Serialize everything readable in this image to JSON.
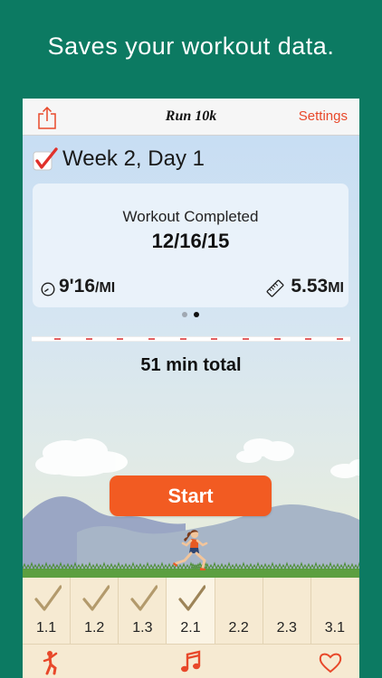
{
  "promo": {
    "headline": "Saves your workout data."
  },
  "navbar": {
    "title": "Run 10k",
    "settings_label": "Settings",
    "share_icon": "share-icon"
  },
  "workout": {
    "week_day": "Week 2, Day 1",
    "checked": true,
    "status": "Workout Completed",
    "date": "12/16/15",
    "pace_value": "9'16",
    "pace_unit": "/MI",
    "distance_value": "5.53",
    "distance_unit": "MI",
    "total": "51 min total"
  },
  "pager": {
    "pages": 2,
    "current_page": 2
  },
  "progress": {
    "segments": 10
  },
  "start_label": "Start",
  "days": [
    {
      "label": "1.1",
      "done": true
    },
    {
      "label": "1.2",
      "done": true
    },
    {
      "label": "1.3",
      "done": true
    },
    {
      "label": "2.1",
      "done": true,
      "current": true
    },
    {
      "label": "2.2",
      "done": false
    },
    {
      "label": "2.3",
      "done": false
    },
    {
      "label": "3.1",
      "done": false
    }
  ],
  "toolbar": {
    "left_icon": "stretch-icon",
    "center_icon": "music-icon",
    "right_icon": "heart-icon"
  },
  "colors": {
    "background": "#0c7a62",
    "accent": "#e8482a",
    "start_button": "#f25b22",
    "check_red": "#e0312b",
    "check_tan": "#b39a6c",
    "dot_active": "#111111",
    "dot_inactive": "#a0a8b2"
  }
}
